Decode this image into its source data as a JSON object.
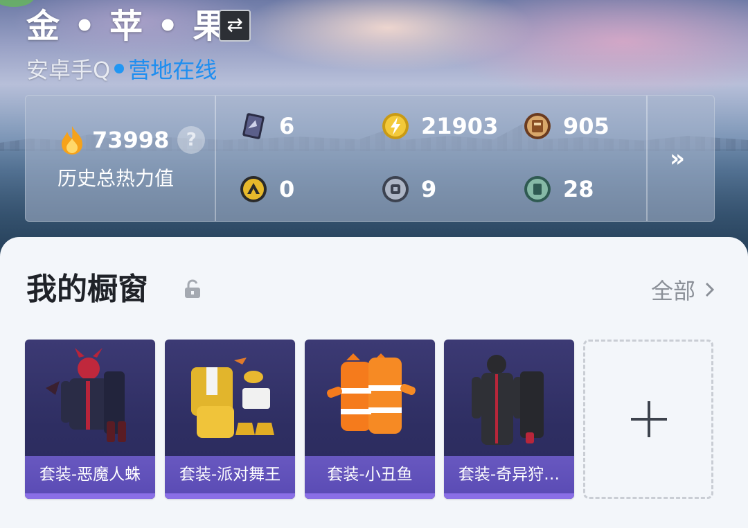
{
  "header": {
    "player_name": "金 • 苹 • 果",
    "switch_icon": "⇄",
    "platform": "安卓手Q",
    "online_status": "营地在线"
  },
  "stats": {
    "heat_value": "73998",
    "heat_label": "历史总热力值",
    "help_icon": "?",
    "more_icon": "»",
    "currencies": [
      {
        "icon": "card-ticket-icon",
        "value": "6"
      },
      {
        "icon": "gold-coin-icon",
        "value": "21903"
      },
      {
        "icon": "crate-coin-icon",
        "value": "905"
      },
      {
        "icon": "gold-token-icon",
        "value": "0"
      },
      {
        "icon": "silver-token-icon",
        "value": "9"
      },
      {
        "icon": "green-token-icon",
        "value": "28"
      }
    ]
  },
  "showcase": {
    "title": "我的橱窗",
    "view_all": "全部",
    "items": [
      {
        "label": "套装-恶魔人蛛"
      },
      {
        "label": "套装-派对舞王"
      },
      {
        "label": "套装-小丑鱼"
      },
      {
        "label": "套装-奇异狩…"
      }
    ]
  },
  "colors": {
    "online": "#1e8ef0",
    "card_label": "#5b4cb5",
    "card_bg": "#2e2e62"
  }
}
